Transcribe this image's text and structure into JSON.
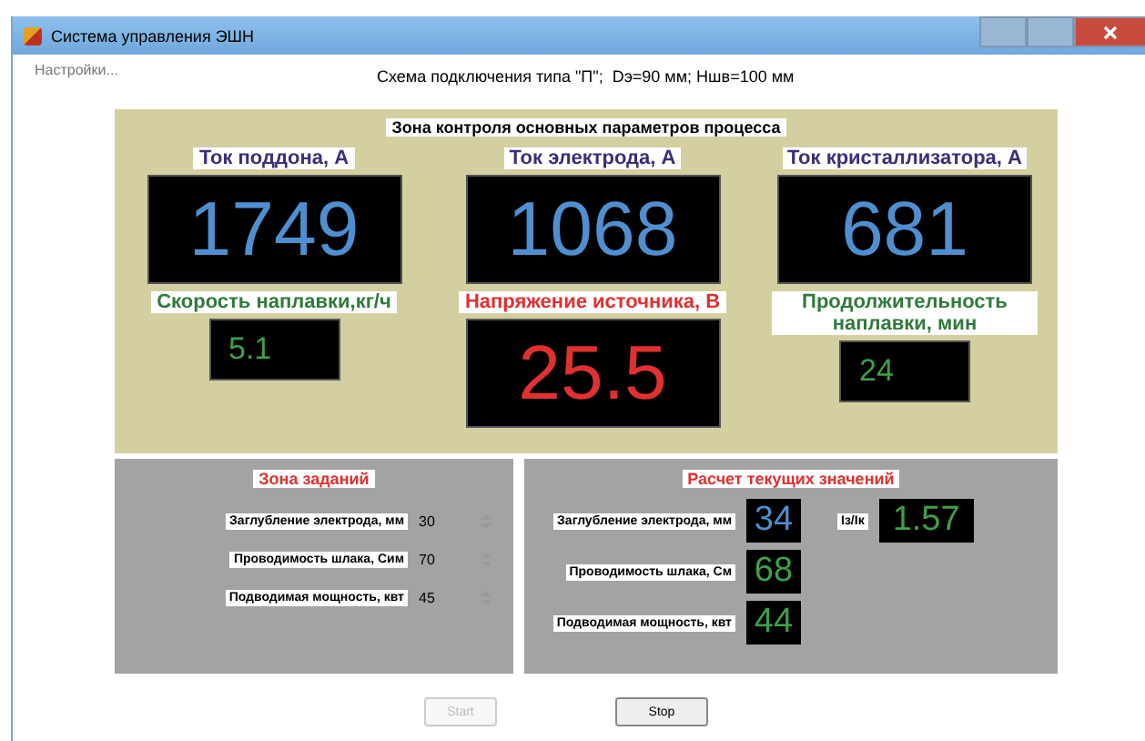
{
  "window": {
    "title": "Система управления ЭШН"
  },
  "menu": {
    "label": "Настройки..."
  },
  "scheme": "Схема подключения типа \"П\";  Dэ=90 мм; Ншв=100 мм",
  "monitor": {
    "title": "Зона контроля основных параметров процесса",
    "displays": [
      {
        "kind": "current",
        "label": "Ток поддона, А",
        "value": "1749"
      },
      {
        "kind": "current",
        "label": "Ток электрода, А",
        "value": "1068"
      },
      {
        "kind": "current",
        "label": "Ток кристаллизатора, А",
        "value": "681"
      },
      {
        "kind": "process",
        "label": "Скорость наплавки,кг/ч",
        "value": "5.1"
      },
      {
        "kind": "voltage",
        "label": "Напряжение источника, В",
        "value": "25.5"
      },
      {
        "kind": "process",
        "label": "Продолжительность наплавки, мин",
        "value": "24"
      }
    ]
  },
  "settings": {
    "title": "Зона заданий",
    "rows": [
      {
        "label": "Заглубление электрода, мм",
        "value": "30"
      },
      {
        "label": "Проводимость шлака, Сим",
        "value": "70"
      },
      {
        "label": "Подводимая мощность, квт",
        "value": "45"
      }
    ]
  },
  "current": {
    "title": "Расчет текущих значений",
    "rows": [
      {
        "kind": "primary",
        "label": "Заглубление электрода, мм",
        "value": "34"
      },
      {
        "kind": "secondary",
        "label": "Проводимость шлака, См",
        "value": "68"
      },
      {
        "kind": "secondary",
        "label": "Подводимая мощность, квт",
        "value": "44"
      }
    ],
    "ratio": {
      "label": "Iз/Iк",
      "value": "1.57"
    }
  },
  "buttons": [
    {
      "label": "Start",
      "disabled": true
    },
    {
      "label": "Stop",
      "disabled": false
    }
  ]
}
